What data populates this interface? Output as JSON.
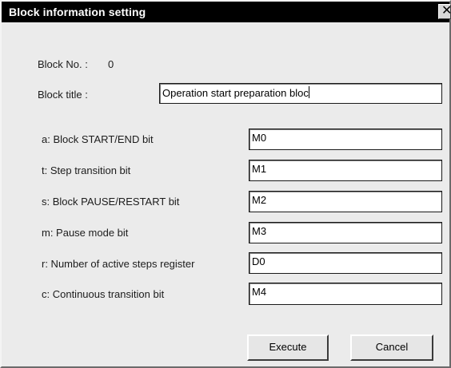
{
  "window": {
    "title": "Block information setting",
    "close_glyph": "✕",
    "close_icon": "close-icon"
  },
  "block": {
    "number_label": "Block No. :",
    "number_value": "0",
    "title_label": "Block title :",
    "title_value": "Operation start preparation bloc"
  },
  "fields": [
    {
      "label": "a: Block START/END bit",
      "value": "M0"
    },
    {
      "label": "t: Step transition bit",
      "value": "M1"
    },
    {
      "label": "s: Block PAUSE/RESTART bit",
      "value": "M2"
    },
    {
      "label": "m: Pause mode bit",
      "value": "M3"
    },
    {
      "label": "r: Number of active steps register",
      "value": "D0"
    },
    {
      "label": "c: Continuous transition bit",
      "value": "M4"
    }
  ],
  "buttons": {
    "execute": "Execute",
    "cancel": "Cancel"
  }
}
